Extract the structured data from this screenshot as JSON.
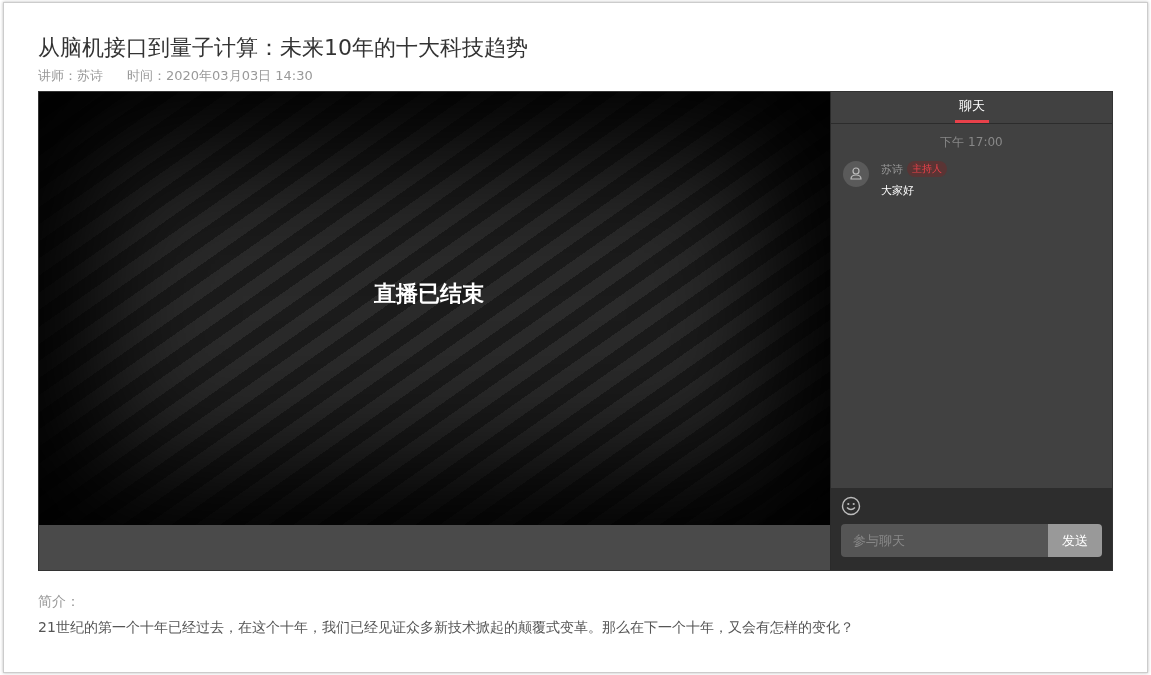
{
  "title": "从脑机接口到量子计算：未来10年的十大科技趋势",
  "meta": {
    "lecturer": "讲师：苏诗",
    "time": "时间：2020年03月03日 14:30"
  },
  "player": {
    "status": "直播已结束"
  },
  "chat": {
    "tabs": [
      {
        "label": "聊天",
        "selected": true
      }
    ],
    "timestamp": "下午 17:00",
    "messages": [
      {
        "author": "苏诗",
        "badge": "主持人",
        "text": "大家好"
      }
    ],
    "input": {
      "placeholder": "参与聊天"
    },
    "send_button": "发送"
  },
  "intro": {
    "label": "简介：",
    "text": "21世纪的第一个十年已经过去，在这个十年，我们已经见证众多新技术掀起的颠覆式变革。那么在下一个十年，又会有怎样的变化？"
  }
}
